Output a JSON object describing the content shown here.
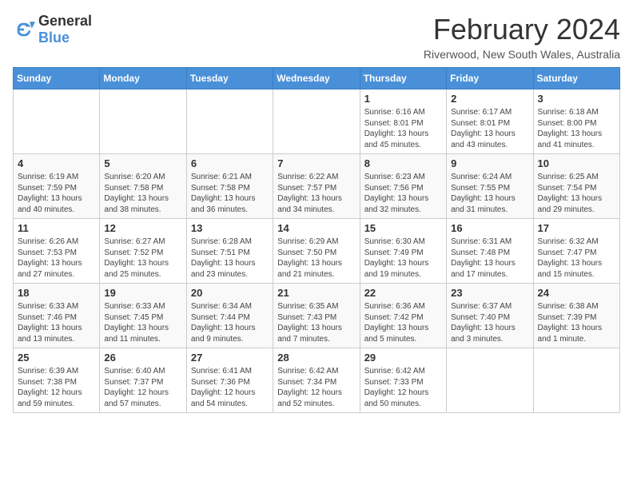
{
  "header": {
    "logo_general": "General",
    "logo_blue": "Blue",
    "title": "February 2024",
    "subtitle": "Riverwood, New South Wales, Australia"
  },
  "columns": [
    "Sunday",
    "Monday",
    "Tuesday",
    "Wednesday",
    "Thursday",
    "Friday",
    "Saturday"
  ],
  "weeks": [
    [
      {
        "day": "",
        "info": ""
      },
      {
        "day": "",
        "info": ""
      },
      {
        "day": "",
        "info": ""
      },
      {
        "day": "",
        "info": ""
      },
      {
        "day": "1",
        "info": "Sunrise: 6:16 AM\nSunset: 8:01 PM\nDaylight: 13 hours and 45 minutes."
      },
      {
        "day": "2",
        "info": "Sunrise: 6:17 AM\nSunset: 8:01 PM\nDaylight: 13 hours and 43 minutes."
      },
      {
        "day": "3",
        "info": "Sunrise: 6:18 AM\nSunset: 8:00 PM\nDaylight: 13 hours and 41 minutes."
      }
    ],
    [
      {
        "day": "4",
        "info": "Sunrise: 6:19 AM\nSunset: 7:59 PM\nDaylight: 13 hours and 40 minutes."
      },
      {
        "day": "5",
        "info": "Sunrise: 6:20 AM\nSunset: 7:58 PM\nDaylight: 13 hours and 38 minutes."
      },
      {
        "day": "6",
        "info": "Sunrise: 6:21 AM\nSunset: 7:58 PM\nDaylight: 13 hours and 36 minutes."
      },
      {
        "day": "7",
        "info": "Sunrise: 6:22 AM\nSunset: 7:57 PM\nDaylight: 13 hours and 34 minutes."
      },
      {
        "day": "8",
        "info": "Sunrise: 6:23 AM\nSunset: 7:56 PM\nDaylight: 13 hours and 32 minutes."
      },
      {
        "day": "9",
        "info": "Sunrise: 6:24 AM\nSunset: 7:55 PM\nDaylight: 13 hours and 31 minutes."
      },
      {
        "day": "10",
        "info": "Sunrise: 6:25 AM\nSunset: 7:54 PM\nDaylight: 13 hours and 29 minutes."
      }
    ],
    [
      {
        "day": "11",
        "info": "Sunrise: 6:26 AM\nSunset: 7:53 PM\nDaylight: 13 hours and 27 minutes."
      },
      {
        "day": "12",
        "info": "Sunrise: 6:27 AM\nSunset: 7:52 PM\nDaylight: 13 hours and 25 minutes."
      },
      {
        "day": "13",
        "info": "Sunrise: 6:28 AM\nSunset: 7:51 PM\nDaylight: 13 hours and 23 minutes."
      },
      {
        "day": "14",
        "info": "Sunrise: 6:29 AM\nSunset: 7:50 PM\nDaylight: 13 hours and 21 minutes."
      },
      {
        "day": "15",
        "info": "Sunrise: 6:30 AM\nSunset: 7:49 PM\nDaylight: 13 hours and 19 minutes."
      },
      {
        "day": "16",
        "info": "Sunrise: 6:31 AM\nSunset: 7:48 PM\nDaylight: 13 hours and 17 minutes."
      },
      {
        "day": "17",
        "info": "Sunrise: 6:32 AM\nSunset: 7:47 PM\nDaylight: 13 hours and 15 minutes."
      }
    ],
    [
      {
        "day": "18",
        "info": "Sunrise: 6:33 AM\nSunset: 7:46 PM\nDaylight: 13 hours and 13 minutes."
      },
      {
        "day": "19",
        "info": "Sunrise: 6:33 AM\nSunset: 7:45 PM\nDaylight: 13 hours and 11 minutes."
      },
      {
        "day": "20",
        "info": "Sunrise: 6:34 AM\nSunset: 7:44 PM\nDaylight: 13 hours and 9 minutes."
      },
      {
        "day": "21",
        "info": "Sunrise: 6:35 AM\nSunset: 7:43 PM\nDaylight: 13 hours and 7 minutes."
      },
      {
        "day": "22",
        "info": "Sunrise: 6:36 AM\nSunset: 7:42 PM\nDaylight: 13 hours and 5 minutes."
      },
      {
        "day": "23",
        "info": "Sunrise: 6:37 AM\nSunset: 7:40 PM\nDaylight: 13 hours and 3 minutes."
      },
      {
        "day": "24",
        "info": "Sunrise: 6:38 AM\nSunset: 7:39 PM\nDaylight: 13 hours and 1 minute."
      }
    ],
    [
      {
        "day": "25",
        "info": "Sunrise: 6:39 AM\nSunset: 7:38 PM\nDaylight: 12 hours and 59 minutes."
      },
      {
        "day": "26",
        "info": "Sunrise: 6:40 AM\nSunset: 7:37 PM\nDaylight: 12 hours and 57 minutes."
      },
      {
        "day": "27",
        "info": "Sunrise: 6:41 AM\nSunset: 7:36 PM\nDaylight: 12 hours and 54 minutes."
      },
      {
        "day": "28",
        "info": "Sunrise: 6:42 AM\nSunset: 7:34 PM\nDaylight: 12 hours and 52 minutes."
      },
      {
        "day": "29",
        "info": "Sunrise: 6:42 AM\nSunset: 7:33 PM\nDaylight: 12 hours and 50 minutes."
      },
      {
        "day": "",
        "info": ""
      },
      {
        "day": "",
        "info": ""
      }
    ]
  ]
}
